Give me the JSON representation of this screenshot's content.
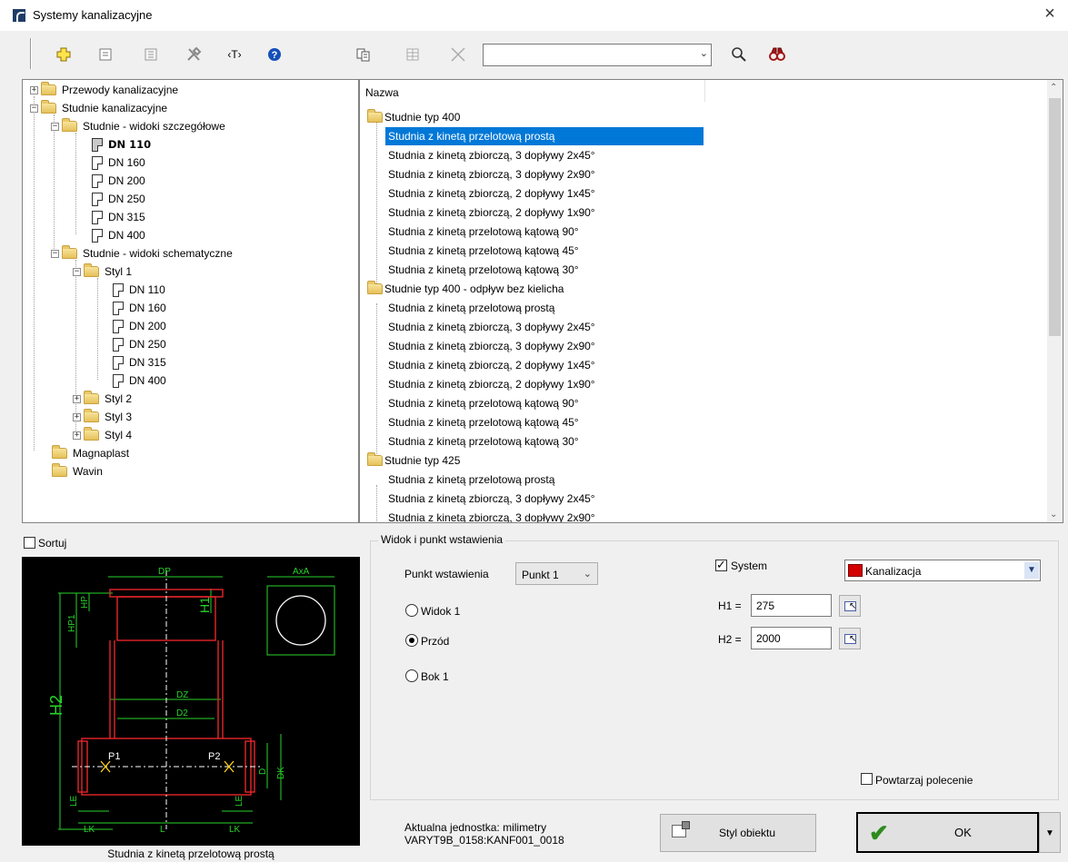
{
  "window": {
    "title": "Systemy kanalizacyjne",
    "close_glyph": "×"
  },
  "toolbar": {
    "icons": [
      "add-icon",
      "properties-icon",
      "list-icon",
      "tools-icon",
      "text-tag-icon",
      "help-icon",
      "copy-icon",
      "grid-icon",
      "delete-icon",
      "search-icon",
      "binoculars-icon"
    ],
    "text_tag": "‹T›",
    "search_value": ""
  },
  "tree": {
    "items": [
      {
        "label": "Przewody kanalizacyjne"
      },
      {
        "label": "Studnie kanalizacyjne"
      },
      {
        "label": "Studnie - widoki szczegółowe"
      },
      {
        "label": "DN 110"
      },
      {
        "label": "DN 160"
      },
      {
        "label": "DN 200"
      },
      {
        "label": "DN 250"
      },
      {
        "label": "DN 315"
      },
      {
        "label": "DN 400"
      },
      {
        "label": "Studnie - widoki schematyczne"
      },
      {
        "label": "Styl 1"
      },
      {
        "label": "DN 110"
      },
      {
        "label": "DN 160"
      },
      {
        "label": "DN 200"
      },
      {
        "label": "DN 250"
      },
      {
        "label": "DN 315"
      },
      {
        "label": "DN 400"
      },
      {
        "label": "Styl 2"
      },
      {
        "label": "Styl 3"
      },
      {
        "label": "Styl 4"
      },
      {
        "label": "Magnaplast"
      },
      {
        "label": "Wavin"
      }
    ]
  },
  "list": {
    "header": "Nazwa",
    "rows": [
      {
        "label": "Studnie typ 400"
      },
      {
        "label": "Studnia z kinetą przelotową prostą"
      },
      {
        "label": "Studnia z kinetą zbiorczą, 3 dopływy 2x45°"
      },
      {
        "label": "Studnia z kinetą zbiorczą, 3 dopływy 2x90°"
      },
      {
        "label": "Studnia z kinetą zbiorczą, 2 dopływy 1x45°"
      },
      {
        "label": "Studnia z kinetą zbiorczą, 2 dopływy 1x90°"
      },
      {
        "label": "Studnia z kinetą przelotową kątową 90°"
      },
      {
        "label": "Studnia z kinetą przelotową kątową 45°"
      },
      {
        "label": "Studnia z kinetą przelotową kątową 30°"
      },
      {
        "label": "Studnie typ 400 - odpływ bez kielicha"
      },
      {
        "label": "Studnia z kinetą przelotową prostą"
      },
      {
        "label": "Studnia z kinetą zbiorczą, 3 dopływy 2x45°"
      },
      {
        "label": "Studnia z kinetą zbiorczą, 3 dopływy 2x90°"
      },
      {
        "label": "Studnia z kinetą zbiorczą, 2 dopływy 1x45°"
      },
      {
        "label": "Studnia z kinetą zbiorczą, 2 dopływy 1x90°"
      },
      {
        "label": "Studnia z kinetą przelotową kątową 90°"
      },
      {
        "label": "Studnia z kinetą przelotową kątową 45°"
      },
      {
        "label": "Studnia z kinetą przelotową kątową 30°"
      },
      {
        "label": "Studnie typ 425"
      },
      {
        "label": "Studnia z kinetą przelotową prostą"
      },
      {
        "label": "Studnia z kinetą zbiorczą, 3 dopływy 2x45°"
      },
      {
        "label": "Studnia z kinetą zbiorczą, 3 dopływy 2x90°"
      }
    ]
  },
  "sortuj_label": "Sortuj",
  "preview": {
    "caption": "Studnia z kinetą przelotową prostą",
    "labels": {
      "dp": "DP",
      "axa": "AxA",
      "hp1": "HP1",
      "hp": "HP",
      "h1": "H1",
      "h2": "H2",
      "dz": "DZ",
      "d2": "D2",
      "p1": "P1",
      "p2": "P2",
      "d": "D",
      "dk": "DK",
      "le_left": "LE",
      "lk_left": "LK",
      "l": "L",
      "le_right": "LE",
      "lk_right": "LK"
    },
    "colors": {
      "background": "#000000",
      "outline": "#e8262a",
      "dimension": "#27d32a",
      "axis": "#ffffff"
    }
  },
  "view_group": {
    "label": "Widok i punkt wstawienia",
    "punkt_label": "Punkt wstawienia",
    "punkt_value": "Punkt 1",
    "radios": [
      "Widok 1",
      "Przód",
      "Bok 1"
    ],
    "selected_radio": "Przód",
    "system_label": "System",
    "system_checked": true,
    "system_value": "Kanalizacja",
    "system_color": "#d40000",
    "h1_label": "H1 =",
    "h1_value": "275",
    "h2_label": "H2 =",
    "h2_value": "2000",
    "powtarzaj_label": "Powtarzaj polecenie",
    "powtarzaj_checked": false
  },
  "footer": {
    "unit_line": "Aktualna jednostka: milimetry",
    "code_line": "VARYT9B_0158:KANF001_0018",
    "styl_label": "Styl obiektu",
    "ok_label": "OK",
    "ok_check": "✔",
    "drop_glyph": "▼"
  }
}
